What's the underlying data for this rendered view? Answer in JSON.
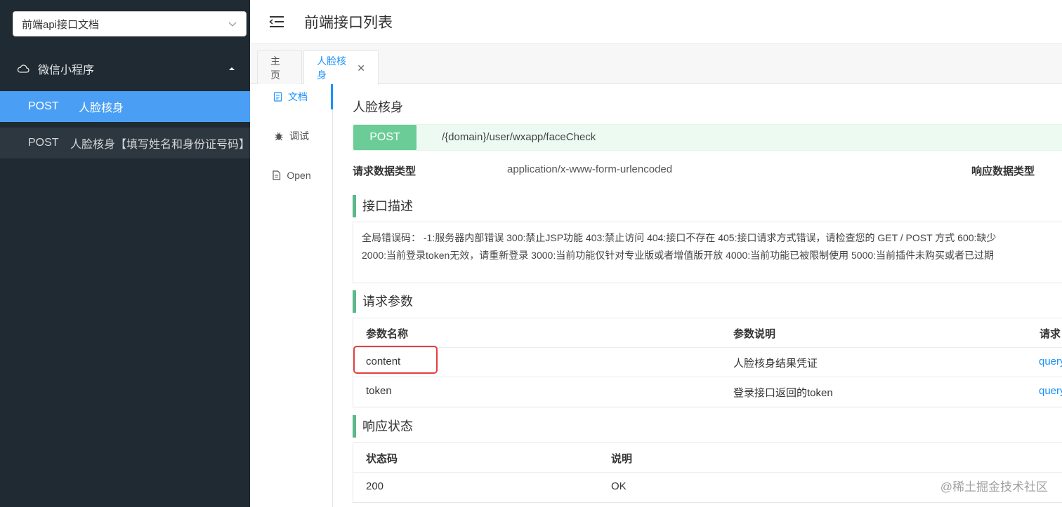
{
  "sidebar": {
    "project_select": "前端api接口文档",
    "group_label": "微信小程序",
    "items": [
      {
        "method": "POST",
        "name": "人脸核身"
      },
      {
        "method": "POST",
        "name": "人脸核身【填写姓名和身份证号码】"
      }
    ]
  },
  "header": {
    "title": "前端接口列表"
  },
  "tabs": {
    "home": "主页",
    "current": "人脸核身"
  },
  "docnav": {
    "doc": "文档",
    "debug": "调试",
    "open": "Open"
  },
  "api": {
    "title": "人脸核身",
    "method": "POST",
    "url": "/{domain}/user/wxapp/faceCheck",
    "req_type_label": "请求数据类型",
    "req_type_value": "application/x-www-form-urlencoded",
    "resp_type_label": "响应数据类型"
  },
  "description": {
    "title": "接口描述",
    "line1": "全局错误码： -1:服务器内部错误 300:禁止JSP功能 403:禁止访问 404:接口不存在 405:接口请求方式错误，请检查您的 GET / POST 方式 600:缺少",
    "line2": "2000:当前登录token无效，请重新登录 3000:当前功能仅针对专业版或者增值版开放 4000:当前功能已被限制使用 5000:当前插件未购买或者已过期"
  },
  "params": {
    "title": "请求参数",
    "headers": [
      "参数名称",
      "参数说明",
      "请求"
    ],
    "rows": [
      {
        "name": "content",
        "desc": "人脸核身结果凭证",
        "type": "query"
      },
      {
        "name": "token",
        "desc": "登录接口返回的token",
        "type": "query"
      }
    ]
  },
  "response": {
    "title": "响应状态",
    "headers": [
      "状态码",
      "说明"
    ],
    "rows": [
      {
        "code": "200",
        "desc": "OK"
      }
    ]
  },
  "watermark": "@稀土掘金技术社区",
  "colors": {
    "sidebar_bg": "#1f2a33",
    "active_item": "#4a9ff5",
    "post_badge": "#6ccc97",
    "section_bar": "#5db88a",
    "link": "#1890ff",
    "highlight": "#e53e3e"
  }
}
